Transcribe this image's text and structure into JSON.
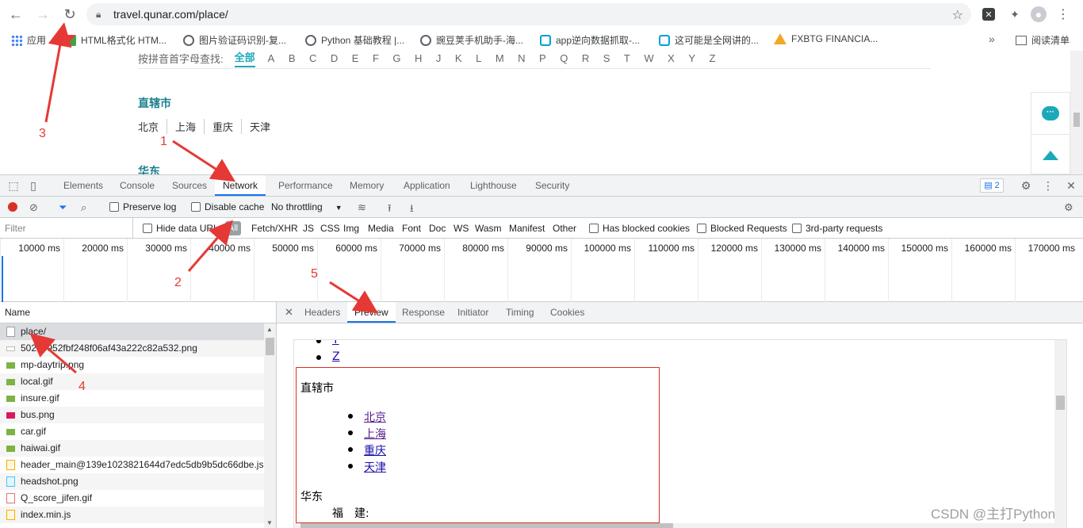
{
  "browser": {
    "url": "travel.qunar.com/place/",
    "bookmarks": [
      {
        "label": "应用",
        "icon": "apps-icon"
      },
      {
        "label": "HTML格式化 HTM...",
        "icon": "highlight-icon"
      },
      {
        "label": "图片验证码识别-复...",
        "icon": "globe-icon"
      },
      {
        "label": "Python 基础教程 |...",
        "icon": "globe-icon"
      },
      {
        "label": "豌豆荚手机助手-海...",
        "icon": "globe-icon"
      },
      {
        "label": "app逆向数据抓取-...",
        "icon": "bilibili-icon"
      },
      {
        "label": "这可能是全网讲的...",
        "icon": "bilibili-icon"
      },
      {
        "label": "FXBTG FINANCIA...",
        "icon": "warning-icon"
      }
    ],
    "more": "»",
    "reading_list": "阅读清单"
  },
  "page": {
    "letter_hint": "按拼音首字母查找:",
    "letter_all": "全部",
    "letters": [
      "A",
      "B",
      "C",
      "D",
      "E",
      "F",
      "G",
      "H",
      "J",
      "K",
      "L",
      "M",
      "N",
      "P",
      "Q",
      "R",
      "S",
      "T",
      "W",
      "X",
      "Y",
      "Z"
    ],
    "section1": "直辖市",
    "cities": [
      "北京",
      "上海",
      "重庆",
      "天津"
    ],
    "section2": "华东"
  },
  "devtools": {
    "tabs": [
      "Elements",
      "Console",
      "Sources",
      "Network",
      "Performance",
      "Memory",
      "Application",
      "Lighthouse",
      "Security"
    ],
    "active_tab": "Network",
    "issues_count": "2",
    "preserve_log": "Preserve log",
    "disable_cache": "Disable cache",
    "throttling": "No throttling",
    "filter_placeholder": "Filter",
    "hide_data_urls": "Hide data URLs",
    "filter_types": [
      "All",
      "Fetch/XHR",
      "JS",
      "CSS",
      "Img",
      "Media",
      "Font",
      "Doc",
      "WS",
      "Wasm",
      "Manifest",
      "Other"
    ],
    "has_blocked_cookies": "Has blocked cookies",
    "blocked_requests": "Blocked Requests",
    "third_party": "3rd-party requests",
    "timeline_ticks": [
      "10000 ms",
      "20000 ms",
      "30000 ms",
      "40000 ms",
      "50000 ms",
      "60000 ms",
      "70000 ms",
      "80000 ms",
      "90000 ms",
      "100000 ms",
      "110000 ms",
      "120000 ms",
      "130000 ms",
      "140000 ms",
      "150000 ms",
      "160000 ms",
      "170000 ms"
    ],
    "name_header": "Name",
    "requests": [
      {
        "name": "place/",
        "type": "doc"
      },
      {
        "name": "50214952fbf248f06af43a222c82a532.png",
        "type": "img-line"
      },
      {
        "name": "mp-daytrip.png",
        "type": "img"
      },
      {
        "name": "local.gif",
        "type": "img"
      },
      {
        "name": "insure.gif",
        "type": "img"
      },
      {
        "name": "bus.png",
        "type": "img-pink"
      },
      {
        "name": "car.gif",
        "type": "img"
      },
      {
        "name": "haiwai.gif",
        "type": "img"
      },
      {
        "name": "header_main@139e1023821644d7edc5db9b5dc66dbe.js",
        "type": "js"
      },
      {
        "name": "headshot.png",
        "type": "png-blue"
      },
      {
        "name": "Q_score_jifen.gif",
        "type": "gif-red"
      },
      {
        "name": "index.min.js",
        "type": "js"
      }
    ],
    "detail_tabs": [
      "Headers",
      "Preview",
      "Response",
      "Initiator",
      "Timing",
      "Cookies"
    ],
    "active_detail_tab": "Preview",
    "preview": {
      "top_links": [
        "Y",
        "Z"
      ],
      "section1": "直辖市",
      "cities": [
        "北京",
        "上海",
        "重庆",
        "天津"
      ],
      "section2": "华东",
      "province": "福　建:"
    }
  },
  "annotations": [
    "1",
    "2",
    "3",
    "4",
    "5"
  ],
  "watermark": "CSDN @主打Python"
}
